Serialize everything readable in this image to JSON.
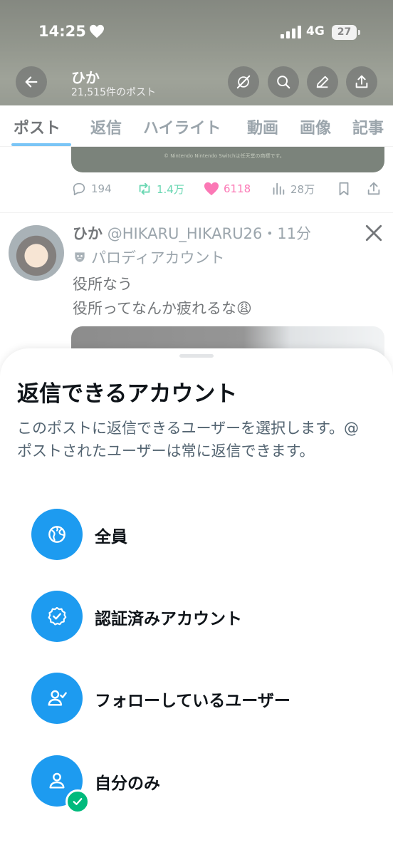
{
  "status_bar": {
    "time": "14:25",
    "network": "4G",
    "battery": "27"
  },
  "header": {
    "title": "ひか",
    "post_count": "21,515件のポスト"
  },
  "tabs": [
    {
      "label": "ポスト"
    },
    {
      "label": "返信"
    },
    {
      "label": "ハイライト"
    },
    {
      "label": "動画"
    },
    {
      "label": "画像"
    },
    {
      "label": "記事"
    }
  ],
  "prev_post": {
    "media_caption": "© Nintendo   Nintendo Switchは任天堂の商標です。",
    "replies": "194",
    "reposts": "1.4万",
    "likes": "6118",
    "views": "28万"
  },
  "post": {
    "display_name": "ひか",
    "handle_time": "@HIKARU_HIKARU26・11分",
    "parody_label": "パロディアカウント",
    "line1": "役所なう",
    "line2": "役所ってなんか疲れるな😩"
  },
  "sheet": {
    "title": "返信できるアカウント",
    "description": "このポストに返信できるユーザーを選択します。@ポストされたユーザーは常に返信できます。",
    "options": [
      {
        "label": "全員",
        "icon": "globe-icon"
      },
      {
        "label": "認証済みアカウント",
        "icon": "verified-badge-icon"
      },
      {
        "label": "フォローしているユーザー",
        "icon": "person-check-icon"
      },
      {
        "label": "自分のみ",
        "icon": "person-icon",
        "selected": true
      }
    ]
  },
  "colors": {
    "accent": "#1d9bf0",
    "selected_check": "#00ba7c",
    "like": "#f91880",
    "repost": "#00ba7c"
  }
}
